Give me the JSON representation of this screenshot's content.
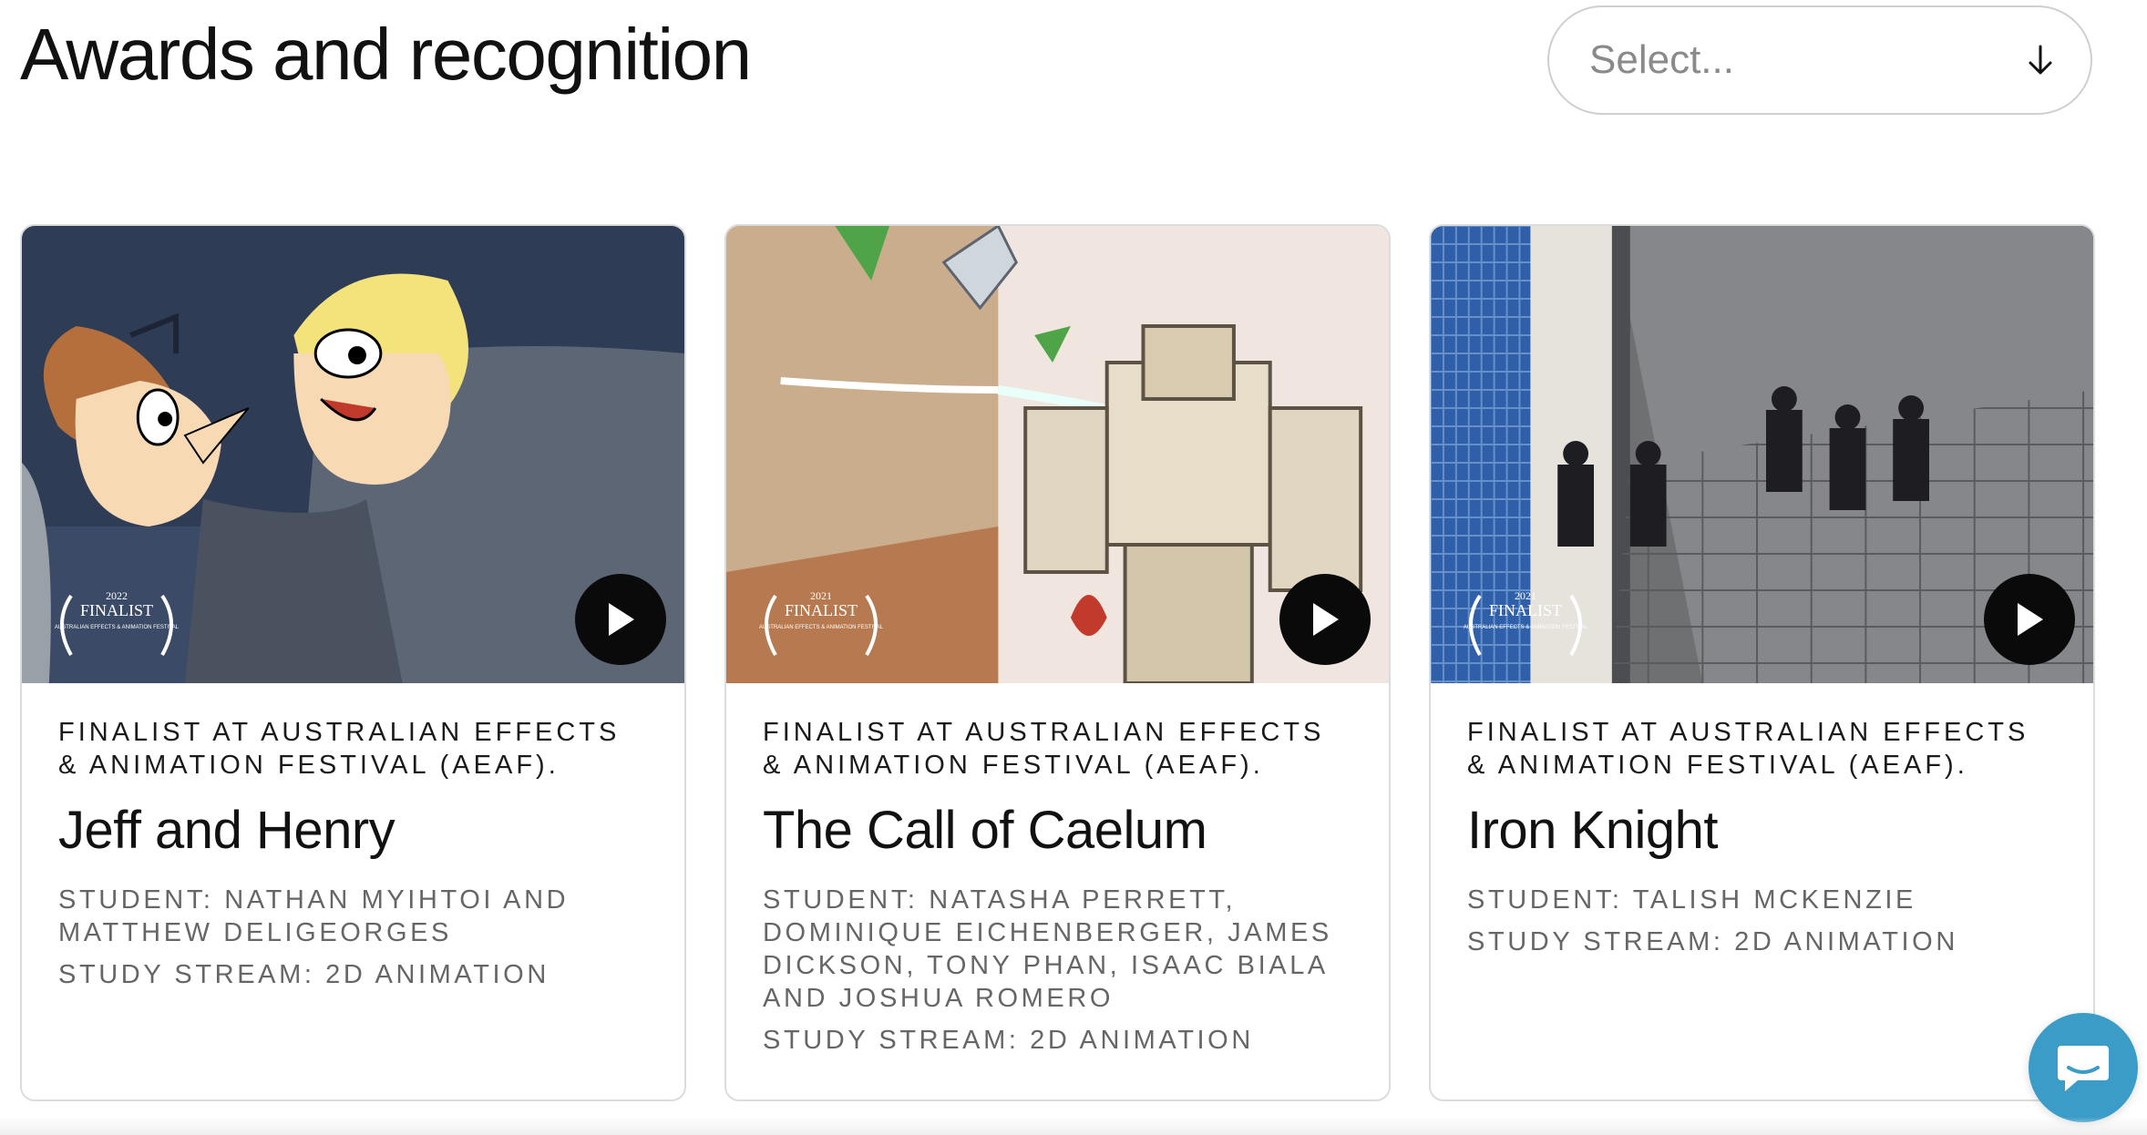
{
  "page": {
    "title": "Awards and recognition"
  },
  "filter": {
    "placeholder": "Select..."
  },
  "cards": [
    {
      "award": "Finalist at Australian Effects & Animation Festival (AEAF).",
      "title": "Jeff and Henry",
      "student": "Student: Nathan Myihtoi and Matthew Deligeorges",
      "stream": "Study stream: 2D animation",
      "badge": {
        "year": "2022",
        "label": "FINALIST",
        "festival": "AUSTRALIAN EFFECTS & ANIMATION FESTIVAL"
      }
    },
    {
      "award": "Finalist at Australian Effects & Animation Festival (AEAF).",
      "title": "The Call of Caelum",
      "student": "Student: Natasha Perrett, Dominique Eichenberger, James Dickson, Tony Phan, Isaac Biala and Joshua Romero",
      "stream": "Study stream: 2D animation",
      "badge": {
        "year": "2021",
        "label": "FINALIST",
        "festival": "AUSTRALIAN EFFECTS & ANIMATION FESTIVAL"
      }
    },
    {
      "award": "Finalist at Australian Effects & Animation Festival (AEAF).",
      "title": "Iron Knight",
      "student": "Student: Talish McKenzie",
      "stream": "Study stream: 2D animation",
      "badge": {
        "year": "2021",
        "label": "FINALIST",
        "festival": "AUSTRALIAN EFFECTS & ANIMATION FESTIVAL"
      }
    }
  ],
  "colors": {
    "chat_button": "#3a9cc7",
    "play_button": "#0a0a0a",
    "meta_text": "#666666"
  },
  "icons": [
    "arrow-down-icon",
    "play-icon",
    "chat-icon",
    "laurel-icon"
  ]
}
